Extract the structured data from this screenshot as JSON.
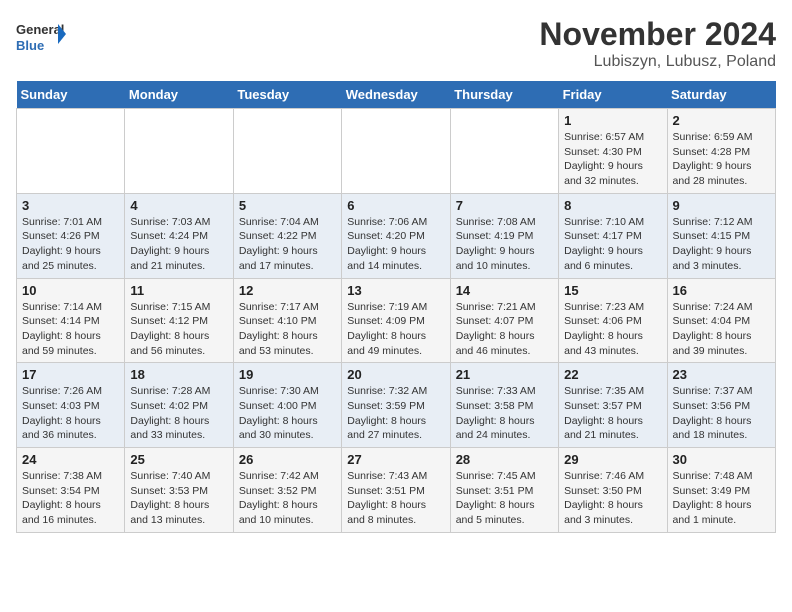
{
  "logo": {
    "line1": "General",
    "line2": "Blue"
  },
  "header": {
    "month": "November 2024",
    "location": "Lubiszyn, Lubusz, Poland"
  },
  "weekdays": [
    "Sunday",
    "Monday",
    "Tuesday",
    "Wednesday",
    "Thursday",
    "Friday",
    "Saturday"
  ],
  "weeks": [
    [
      {
        "day": "",
        "info": ""
      },
      {
        "day": "",
        "info": ""
      },
      {
        "day": "",
        "info": ""
      },
      {
        "day": "",
        "info": ""
      },
      {
        "day": "",
        "info": ""
      },
      {
        "day": "1",
        "info": "Sunrise: 6:57 AM\nSunset: 4:30 PM\nDaylight: 9 hours\nand 32 minutes."
      },
      {
        "day": "2",
        "info": "Sunrise: 6:59 AM\nSunset: 4:28 PM\nDaylight: 9 hours\nand 28 minutes."
      }
    ],
    [
      {
        "day": "3",
        "info": "Sunrise: 7:01 AM\nSunset: 4:26 PM\nDaylight: 9 hours\nand 25 minutes."
      },
      {
        "day": "4",
        "info": "Sunrise: 7:03 AM\nSunset: 4:24 PM\nDaylight: 9 hours\nand 21 minutes."
      },
      {
        "day": "5",
        "info": "Sunrise: 7:04 AM\nSunset: 4:22 PM\nDaylight: 9 hours\nand 17 minutes."
      },
      {
        "day": "6",
        "info": "Sunrise: 7:06 AM\nSunset: 4:20 PM\nDaylight: 9 hours\nand 14 minutes."
      },
      {
        "day": "7",
        "info": "Sunrise: 7:08 AM\nSunset: 4:19 PM\nDaylight: 9 hours\nand 10 minutes."
      },
      {
        "day": "8",
        "info": "Sunrise: 7:10 AM\nSunset: 4:17 PM\nDaylight: 9 hours\nand 6 minutes."
      },
      {
        "day": "9",
        "info": "Sunrise: 7:12 AM\nSunset: 4:15 PM\nDaylight: 9 hours\nand 3 minutes."
      }
    ],
    [
      {
        "day": "10",
        "info": "Sunrise: 7:14 AM\nSunset: 4:14 PM\nDaylight: 8 hours\nand 59 minutes."
      },
      {
        "day": "11",
        "info": "Sunrise: 7:15 AM\nSunset: 4:12 PM\nDaylight: 8 hours\nand 56 minutes."
      },
      {
        "day": "12",
        "info": "Sunrise: 7:17 AM\nSunset: 4:10 PM\nDaylight: 8 hours\nand 53 minutes."
      },
      {
        "day": "13",
        "info": "Sunrise: 7:19 AM\nSunset: 4:09 PM\nDaylight: 8 hours\nand 49 minutes."
      },
      {
        "day": "14",
        "info": "Sunrise: 7:21 AM\nSunset: 4:07 PM\nDaylight: 8 hours\nand 46 minutes."
      },
      {
        "day": "15",
        "info": "Sunrise: 7:23 AM\nSunset: 4:06 PM\nDaylight: 8 hours\nand 43 minutes."
      },
      {
        "day": "16",
        "info": "Sunrise: 7:24 AM\nSunset: 4:04 PM\nDaylight: 8 hours\nand 39 minutes."
      }
    ],
    [
      {
        "day": "17",
        "info": "Sunrise: 7:26 AM\nSunset: 4:03 PM\nDaylight: 8 hours\nand 36 minutes."
      },
      {
        "day": "18",
        "info": "Sunrise: 7:28 AM\nSunset: 4:02 PM\nDaylight: 8 hours\nand 33 minutes."
      },
      {
        "day": "19",
        "info": "Sunrise: 7:30 AM\nSunset: 4:00 PM\nDaylight: 8 hours\nand 30 minutes."
      },
      {
        "day": "20",
        "info": "Sunrise: 7:32 AM\nSunset: 3:59 PM\nDaylight: 8 hours\nand 27 minutes."
      },
      {
        "day": "21",
        "info": "Sunrise: 7:33 AM\nSunset: 3:58 PM\nDaylight: 8 hours\nand 24 minutes."
      },
      {
        "day": "22",
        "info": "Sunrise: 7:35 AM\nSunset: 3:57 PM\nDaylight: 8 hours\nand 21 minutes."
      },
      {
        "day": "23",
        "info": "Sunrise: 7:37 AM\nSunset: 3:56 PM\nDaylight: 8 hours\nand 18 minutes."
      }
    ],
    [
      {
        "day": "24",
        "info": "Sunrise: 7:38 AM\nSunset: 3:54 PM\nDaylight: 8 hours\nand 16 minutes."
      },
      {
        "day": "25",
        "info": "Sunrise: 7:40 AM\nSunset: 3:53 PM\nDaylight: 8 hours\nand 13 minutes."
      },
      {
        "day": "26",
        "info": "Sunrise: 7:42 AM\nSunset: 3:52 PM\nDaylight: 8 hours\nand 10 minutes."
      },
      {
        "day": "27",
        "info": "Sunrise: 7:43 AM\nSunset: 3:51 PM\nDaylight: 8 hours\nand 8 minutes."
      },
      {
        "day": "28",
        "info": "Sunrise: 7:45 AM\nSunset: 3:51 PM\nDaylight: 8 hours\nand 5 minutes."
      },
      {
        "day": "29",
        "info": "Sunrise: 7:46 AM\nSunset: 3:50 PM\nDaylight: 8 hours\nand 3 minutes."
      },
      {
        "day": "30",
        "info": "Sunrise: 7:48 AM\nSunset: 3:49 PM\nDaylight: 8 hours\nand 1 minute."
      }
    ]
  ]
}
